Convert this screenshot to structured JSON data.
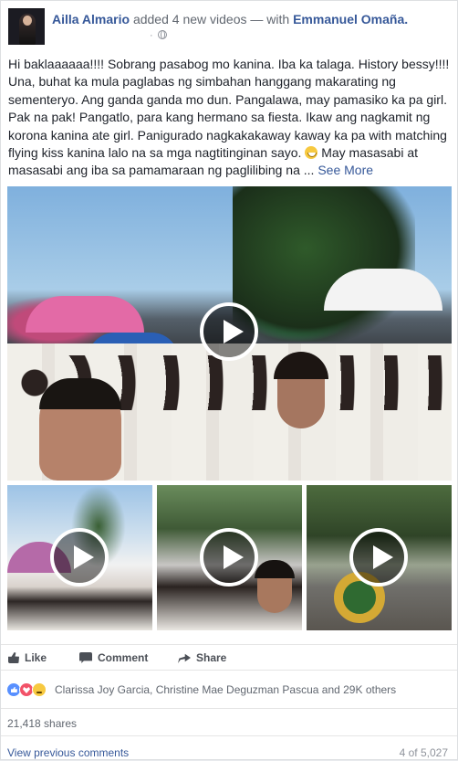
{
  "post": {
    "author": "Ailla Almario",
    "action": "added 4 new videos",
    "with_text": "— with",
    "tagged": "Emmanuel Omaña.",
    "meta_dot": "·",
    "text_lines": [
      "Hi baklaaaaaa!!!! Sobrang pasabog mo kanina. Iba ka talaga. History bessy!!!!",
      "Una, buhat ka mula paglabas ng simbahan hanggang makarating ng",
      "sementeryo. Ang ganda ganda mo dun. Pangalawa, may pamasiko ka pa girl.",
      "Pak na pak! Pangatlo, para kang hermano sa fiesta. Ikaw ang nagkamit ng",
      "korona kanina ate girl. Panigurado nagkakakaway kaway ka pa with matching",
      "flying kiss kanina lalo na sa mga nagtitinginan sayo."
    ],
    "text_tail": " May masasabi at",
    "text_last": "masasabi ang iba sa pamamaraan ng paglilibing na ... ",
    "see_more": "See More"
  },
  "icons": {
    "avatar": "profile-photo",
    "privacy": "globe-icon",
    "emoji": "grinning-face-emoji",
    "play": "play-icon",
    "like": "thumbs-up-icon",
    "comment": "comment-icon",
    "share": "share-arrow-icon"
  },
  "actions": {
    "like": "Like",
    "comment": "Comment",
    "share": "Share"
  },
  "reactions": {
    "types": [
      "like",
      "love",
      "sad"
    ],
    "names": "Clarissa Joy Garcia, Christine Mae Deguzman Pascua and 29K others"
  },
  "shares": "21,418 shares",
  "comments": {
    "view_previous": "View previous comments",
    "count": "4 of 5,027"
  },
  "colors": {
    "link": "#365899",
    "text": "#1d2129",
    "muted": "#616770",
    "like_blue": "#5890ff",
    "love_red": "#f25268",
    "sad_yellow": "#f7c940"
  }
}
